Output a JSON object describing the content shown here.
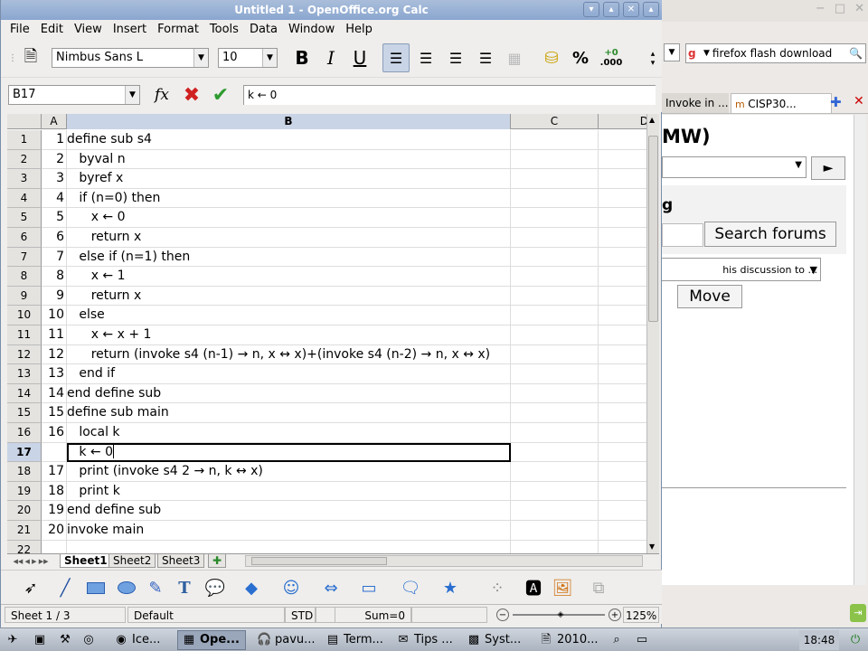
{
  "window": {
    "title": "Untitled 1 - OpenOffice.org Calc"
  },
  "menu": [
    "File",
    "Edit",
    "View",
    "Insert",
    "Format",
    "Tools",
    "Data",
    "Window",
    "Help"
  ],
  "toolbar": {
    "font_name": "Nimbus Sans L",
    "font_size": "10",
    "bold": "B",
    "italic": "I",
    "underline": "U",
    "percent": "%",
    "add_decimal_top": "+0",
    "add_decimal_bottom": ".000"
  },
  "formula_bar": {
    "cell_ref": "B17",
    "function_icon": "fx",
    "contents": "k ← 0"
  },
  "columns": [
    "A",
    "B",
    "C",
    "D"
  ],
  "selected_column": "B",
  "rows": [
    {
      "n": "1",
      "a": "1",
      "b": "define sub s4"
    },
    {
      "n": "2",
      "a": "2",
      "b": "   byval n"
    },
    {
      "n": "3",
      "a": "3",
      "b": "   byref x"
    },
    {
      "n": "4",
      "a": "4",
      "b": "   if (n=0) then"
    },
    {
      "n": "5",
      "a": "5",
      "b": "      x ← 0"
    },
    {
      "n": "6",
      "a": "6",
      "b": "      return x"
    },
    {
      "n": "7",
      "a": "7",
      "b": "   else if (n=1) then"
    },
    {
      "n": "8",
      "a": "8",
      "b": "      x ← 1"
    },
    {
      "n": "9",
      "a": "9",
      "b": "      return x"
    },
    {
      "n": "10",
      "a": "10",
      "b": "   else"
    },
    {
      "n": "11",
      "a": "11",
      "b": "      x ← x + 1"
    },
    {
      "n": "12",
      "a": "12",
      "b": "      return (invoke s4 (n-1) → n, x ↔ x)+(invoke s4 (n-2) → n, x ↔ x)"
    },
    {
      "n": "13",
      "a": "13",
      "b": "   end if"
    },
    {
      "n": "14",
      "a": "14",
      "b": "end define sub"
    },
    {
      "n": "15",
      "a": "15",
      "b": "define sub main"
    },
    {
      "n": "16",
      "a": "16",
      "b": "   local k"
    },
    {
      "n": "17",
      "a": "",
      "b": "   k ← 0"
    },
    {
      "n": "18",
      "a": "17",
      "b": "   print (invoke s4 2 → n, k ↔ x)"
    },
    {
      "n": "19",
      "a": "18",
      "b": "   print k"
    },
    {
      "n": "20",
      "a": "19",
      "b": "end define sub"
    },
    {
      "n": "21",
      "a": "20",
      "b": "invoke main"
    },
    {
      "n": "22",
      "a": "",
      "b": ""
    }
  ],
  "active_row": "17",
  "sheets": [
    "Sheet1",
    "Sheet2",
    "Sheet3"
  ],
  "status": {
    "sheet": "Sheet 1 / 3",
    "style": "Default",
    "mode": "STD",
    "sum": "Sum=0",
    "zoom": "125%"
  },
  "browser": {
    "search_text": "firefox flash download",
    "tab1": "Invoke in ...",
    "tab2": "CISP30...",
    "heading": "MW)",
    "subheading": "g",
    "search_button": "Search forums",
    "discussion_select": "his discussion to ...",
    "move_button": "Move",
    "go_button": "►"
  },
  "taskbar": {
    "items": [
      "Ice...",
      "Ope...",
      "pavu...",
      "Term...",
      "Tips ...",
      "Syst...",
      "2010..."
    ],
    "clock": "18:48"
  },
  "colors": {
    "title_bar": "#8aa6cf",
    "selection_header": "#c9d4e6",
    "taskbar": "#aab3bf"
  }
}
